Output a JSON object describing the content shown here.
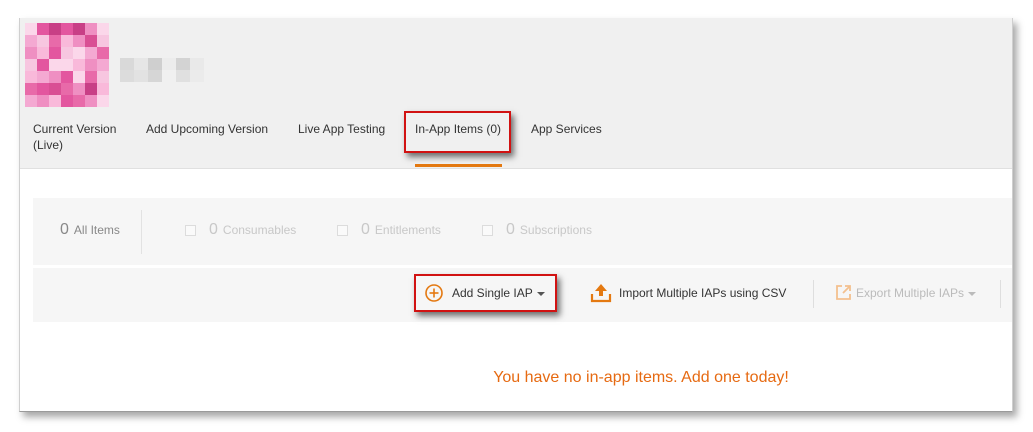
{
  "colors": {
    "accent": "#e47911",
    "highlight": "#d11212",
    "empty_message": "#e66a12"
  },
  "tabs": [
    {
      "line1": "Current Version",
      "line2": "(Live)",
      "active": false
    },
    {
      "line1": "Add Upcoming Version",
      "line2": "",
      "active": false
    },
    {
      "line1": "Live App Testing",
      "line2": "",
      "active": false
    },
    {
      "line1": "In-App Items (0)",
      "line2": "",
      "active": true
    },
    {
      "line1": "App Services",
      "line2": "",
      "active": false
    }
  ],
  "stats": {
    "all": {
      "count": "0",
      "label": "All Items"
    },
    "consumables": {
      "count": "0",
      "label": "Consumables"
    },
    "entitlements": {
      "count": "0",
      "label": "Entitlements"
    },
    "subscriptions": {
      "count": "0",
      "label": "Subscriptions"
    }
  },
  "actions": {
    "add_single": {
      "label": "Add Single IAP",
      "icon": "plus-circle-icon"
    },
    "import_csv": {
      "label": "Import Multiple IAPs using CSV",
      "icon": "upload-icon"
    },
    "export": {
      "label": "Export Multiple IAPs",
      "icon": "external-link-icon"
    }
  },
  "empty_message": "You have no in-app items. Add one today!"
}
